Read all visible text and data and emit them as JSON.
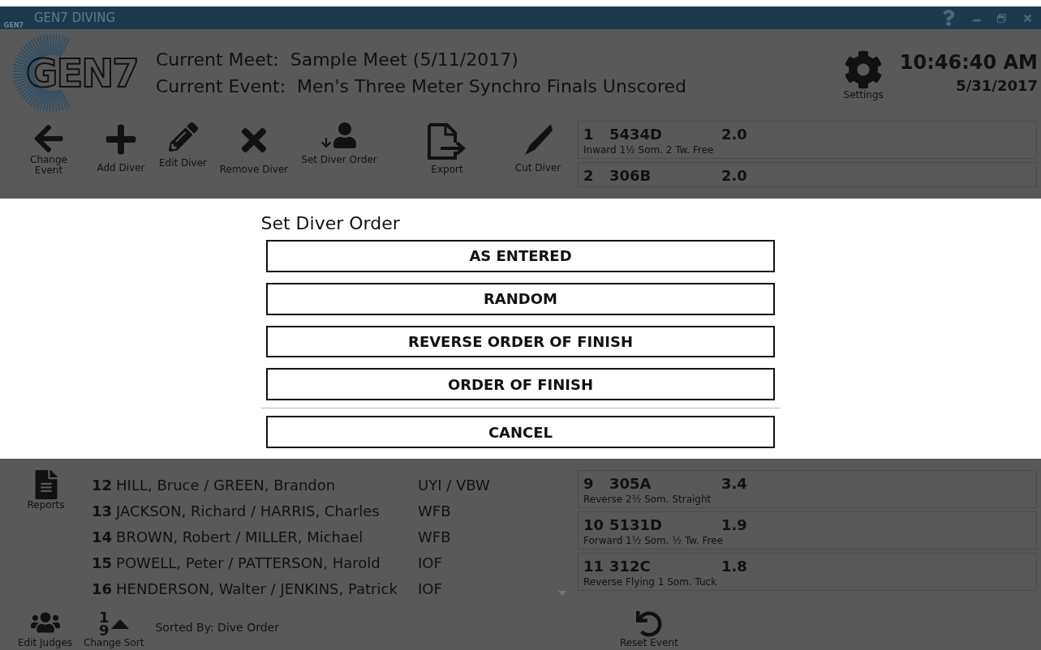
{
  "window": {
    "title": "GEN7 DIVING",
    "icon_text": "GEN7"
  },
  "header": {
    "logo_text": "GEN7",
    "meet_label": "Current Meet:",
    "meet": "Sample Meet (5/11/2017)",
    "event_label": "Current Event:",
    "event": "Men's Three Meter Synchro Finals Unscored",
    "settings_label": "Settings",
    "time": "10:46:40 AM",
    "date": "5/31/2017"
  },
  "toolbar": [
    {
      "kind": "back",
      "label": "Change Event"
    },
    {
      "kind": "add",
      "label": "Add Diver"
    },
    {
      "kind": "edit",
      "label": "Edit Diver"
    },
    {
      "kind": "remove",
      "label": "Remove Diver"
    },
    {
      "kind": "order",
      "label": "Set Diver Order"
    },
    {
      "kind": "export",
      "label": "Export"
    },
    {
      "kind": "cut",
      "label": "Cut Diver"
    }
  ],
  "dives_top": [
    {
      "number": "1",
      "code": "5434D",
      "dd": "2.0",
      "description": "Inward 1½ Som. 2 Tw. Free"
    },
    {
      "number": "2",
      "code": "306B",
      "dd": "2.0"
    }
  ],
  "dialog": {
    "title": "Set Diver Order",
    "options": [
      "AS ENTERED",
      "RANDOM",
      "REVERSE ORDER OF FINISH",
      "ORDER OF FINISH"
    ],
    "cancel": "CANCEL"
  },
  "reports_label": "Reports",
  "divers": [
    {
      "number": "12",
      "name": "HILL, Bruce / GREEN, Brandon",
      "team": "UYI / VBW"
    },
    {
      "number": "13",
      "name": "JACKSON, Richard / HARRIS, Charles",
      "team": "WFB"
    },
    {
      "number": "14",
      "name": "BROWN, Robert / MILLER, Michael",
      "team": "WFB"
    },
    {
      "number": "15",
      "name": "POWELL, Peter / PATTERSON, Harold",
      "team": "IOF"
    },
    {
      "number": "16",
      "name": "HENDERSON, Walter / JENKINS, Patrick",
      "team": "IOF"
    }
  ],
  "dives_bottom": [
    {
      "number": "9",
      "code": "305A",
      "dd": "3.4",
      "description": "Reverse 2½ Som. Straight"
    },
    {
      "number": "10",
      "code": "5131D",
      "dd": "1.9",
      "description": "Forward 1½ Som. ½ Tw. Free"
    },
    {
      "number": "11",
      "code": "312C",
      "dd": "1.8",
      "description": "Reverse Flying 1 Som. Tuck"
    }
  ],
  "bottom_bar": {
    "edit_judges": "Edit Judges",
    "sort_digits": [
      "1",
      "9"
    ],
    "change_sort": "Change Sort",
    "sorted_by": "Sorted By: Dive Order",
    "reset_event": "Reset Event"
  }
}
